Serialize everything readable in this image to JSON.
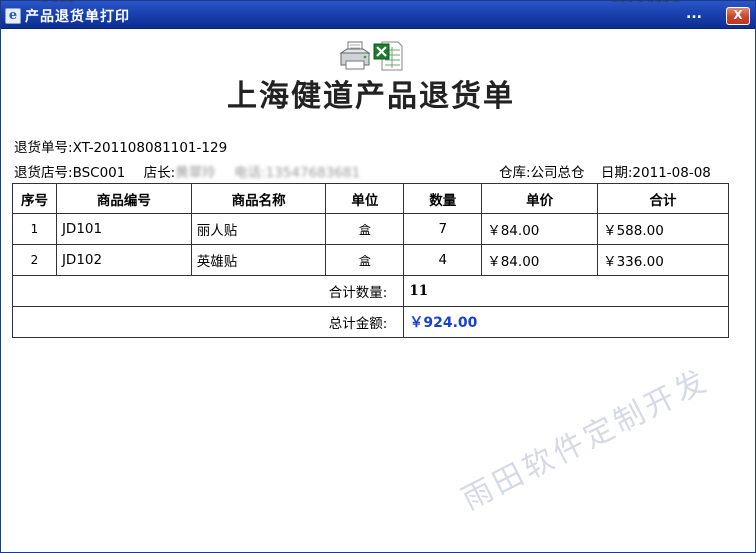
{
  "window": {
    "title": "产品退货单打印",
    "app_icon": "ie-e-icon",
    "minimize_label": "...",
    "close_label": "X",
    "title_gradient": [
      "#2b56c8",
      "#0c2e92"
    ],
    "close_color": "#c9452a"
  },
  "toolbar": {
    "icons": [
      "printer-icon",
      "excel-icon"
    ]
  },
  "document": {
    "title": "上海健道产品退货单",
    "return_no_label": "退货单号:",
    "return_no": "XT-201108081101-129",
    "store_label": "退货店号:",
    "store": "BSC001",
    "manager_label": "店长:",
    "manager": "黄翠玲",
    "phone_label": "电话:",
    "phone": "13547683681",
    "warehouse_label": "仓库:",
    "warehouse": "公司总仓",
    "date_label": "日期:",
    "date": "2011-08-08"
  },
  "table": {
    "headers": [
      "序号",
      "商品编号",
      "商品名称",
      "单位",
      "数量",
      "单价",
      "合计"
    ],
    "rows": [
      {
        "no": "1",
        "code": "JD101",
        "name": "丽人贴",
        "unit": "盒",
        "qty": "7",
        "price": "￥84.00",
        "total": "￥588.00"
      },
      {
        "no": "2",
        "code": "JD102",
        "name": "英雄贴",
        "unit": "盒",
        "qty": "4",
        "price": "￥84.00",
        "total": "￥336.00"
      }
    ],
    "total_qty_label": "合计数量:",
    "total_qty": "11",
    "total_amount_label": "总计金额:",
    "total_amount": "￥924.00",
    "amount_color": "#1a3fd8"
  },
  "watermark": "雨田软件定制开发"
}
